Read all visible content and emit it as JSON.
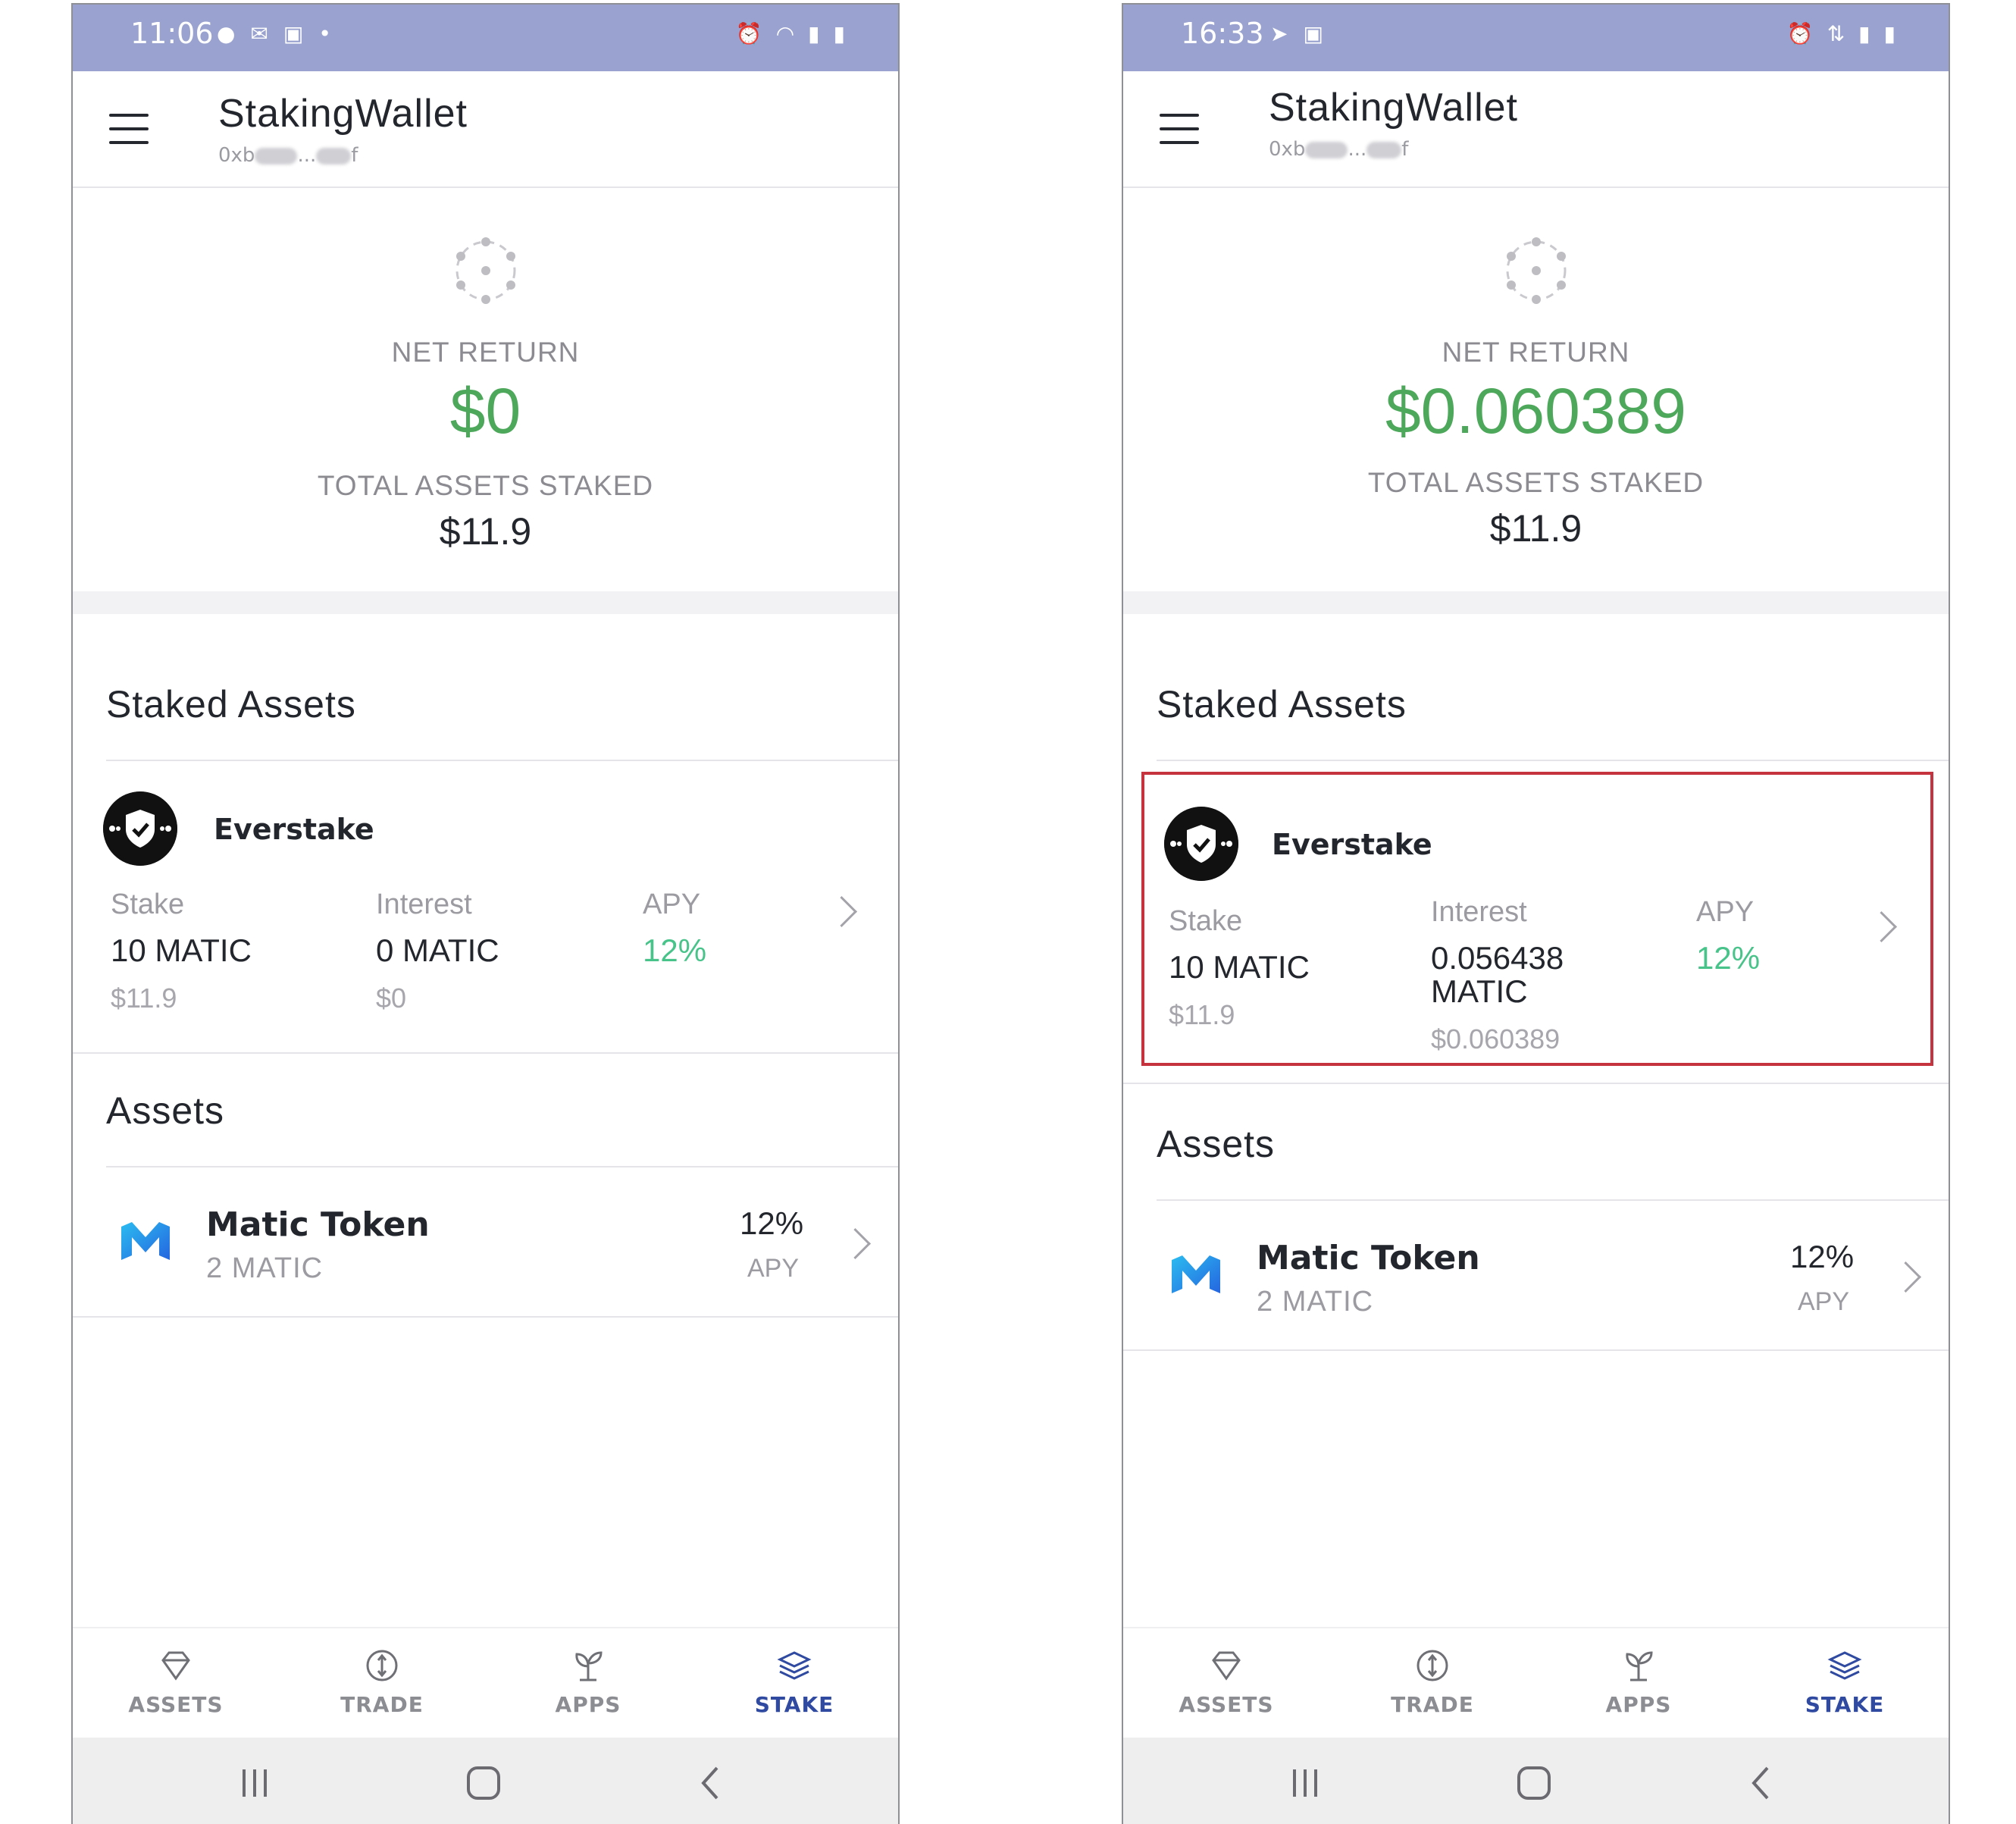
{
  "phones": [
    {
      "status": {
        "time": "11:06"
      },
      "app": {
        "title": "StakingWallet",
        "address_prefix": "0xb",
        "address_mid": "...",
        "address_suffix": "f"
      },
      "summary": {
        "net_return_label": "NET RETURN",
        "net_return_value": "$0",
        "total_label": "TOTAL ASSETS STAKED",
        "total_value": "$11.9"
      },
      "staked": {
        "section_title": "Staked Assets",
        "provider": "Everstake",
        "stake_label": "Stake",
        "stake_value": "10 MATIC",
        "stake_usd": "$11.9",
        "interest_label": "Interest",
        "interest_value": "0 MATIC",
        "interest_usd": "$0",
        "apy_label": "APY",
        "apy_value": "12%"
      },
      "assets": {
        "section_title": "Assets",
        "name": "Matic Token",
        "amount": "2 MATIC",
        "apy_value": "12%",
        "apy_label": "APY"
      }
    },
    {
      "status": {
        "time": "16:33"
      },
      "app": {
        "title": "StakingWallet",
        "address_prefix": "0xb",
        "address_mid": "...",
        "address_suffix": "f"
      },
      "summary": {
        "net_return_label": "NET RETURN",
        "net_return_value": "$0.060389",
        "total_label": "TOTAL ASSETS STAKED",
        "total_value": "$11.9"
      },
      "staked": {
        "section_title": "Staked Assets",
        "provider": "Everstake",
        "stake_label": "Stake",
        "stake_value": "10 MATIC",
        "stake_usd": "$11.9",
        "interest_label": "Interest",
        "interest_value_line1": "0.056438",
        "interest_value_line2": "MATIC",
        "interest_usd": "$0.060389",
        "apy_label": "APY",
        "apy_value": "12%"
      },
      "assets": {
        "section_title": "Assets",
        "name": "Matic Token",
        "amount": "2 MATIC",
        "apy_value": "12%",
        "apy_label": "APY"
      }
    }
  ],
  "nav": {
    "assets": "ASSETS",
    "trade": "TRADE",
    "apps": "APPS",
    "stake": "STAKE"
  },
  "colors": {
    "status_bar": "#9aa3cf",
    "net_return": "#4ea85b",
    "apy": "#48c38a",
    "active_nav": "#2f4aa0",
    "highlight_box": "#c5333f"
  },
  "icons": [
    "menu-icon",
    "staking-logo-icon",
    "everstake-shield-icon",
    "matic-logo-icon",
    "chevron-right-icon",
    "diamond-icon",
    "trade-icon",
    "sprout-icon",
    "layers-icon"
  ]
}
